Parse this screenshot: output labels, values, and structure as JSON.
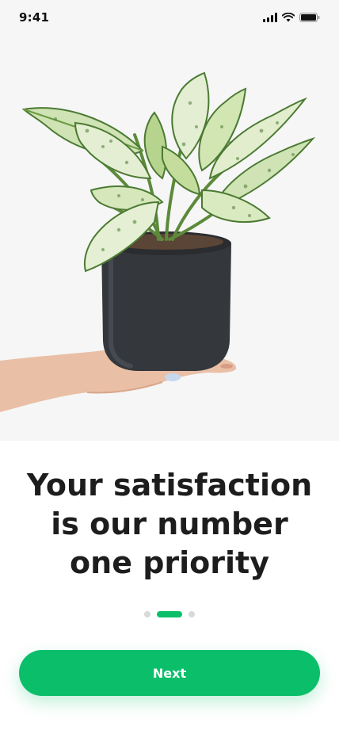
{
  "status_bar": {
    "time": "9:41",
    "icons": [
      "signal-icon",
      "wifi-icon",
      "battery-icon"
    ]
  },
  "hero": {
    "image": "potted-plant-in-hand-image"
  },
  "onboarding": {
    "headline": "Your satisfaction is our number one priority",
    "page_indicator": {
      "total": 3,
      "active_index": 1
    }
  },
  "actions": {
    "next_label": "Next"
  },
  "colors": {
    "accent": "#0bbf6a",
    "background": "#ffffff",
    "hero_background": "#f6f6f6",
    "text": "#1d1d1d"
  }
}
